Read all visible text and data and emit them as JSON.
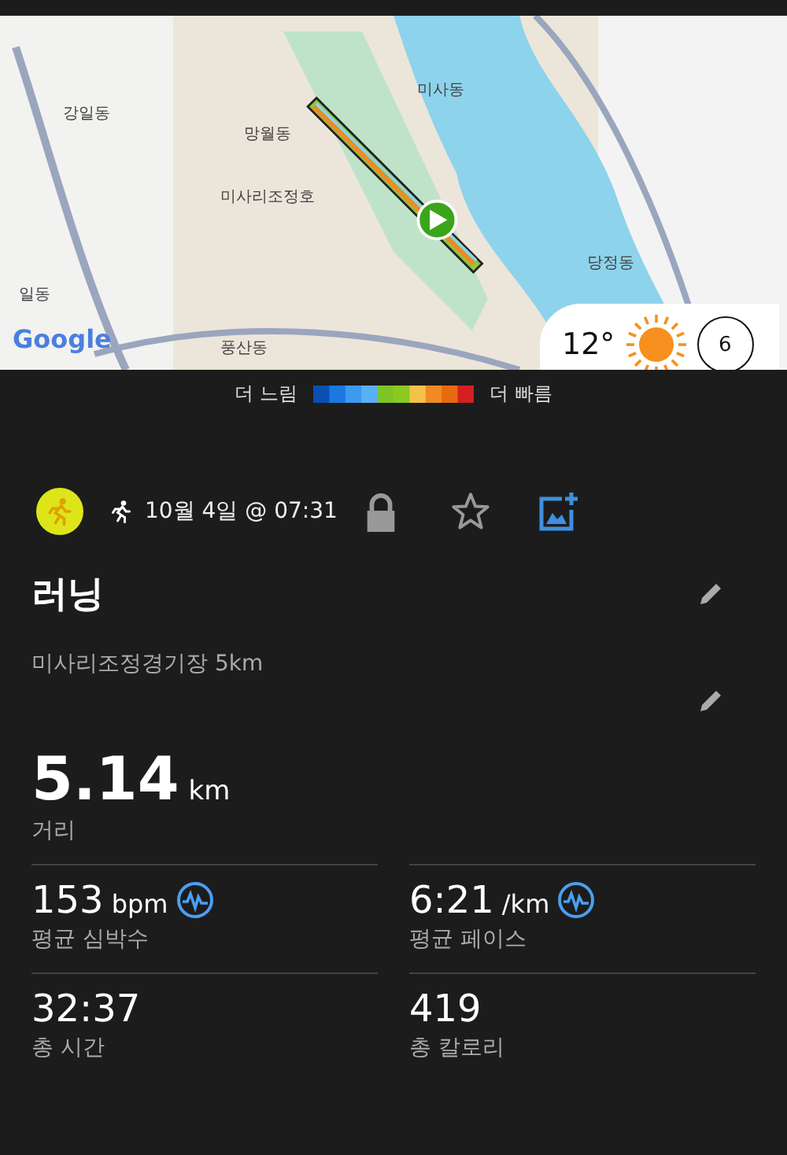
{
  "map": {
    "labels": [
      "강일동",
      "망월동",
      "미사동",
      "미사리조정호",
      "당정동",
      "일동",
      "풍산동"
    ],
    "attribution": "Google",
    "weather": {
      "temperature": "12°",
      "badge": "6"
    }
  },
  "legend": {
    "slow": "더 느림",
    "fast": "더 빠름"
  },
  "activity": {
    "date": "10월 4일 @ 07:31",
    "title": "러닝",
    "description": "미사리조정경기장 5km"
  },
  "distance": {
    "value": "5.14",
    "unit": "km",
    "label": "거리"
  },
  "stats": [
    {
      "value": "153",
      "unit": "bpm",
      "label": "평균 심박수",
      "chart_link": true
    },
    {
      "value": "6:21",
      "unit": "/km",
      "label": "평균 페이스",
      "chart_link": true
    },
    {
      "value": "32:37",
      "label": "총 시간",
      "chart_link": false
    },
    {
      "value": "419",
      "label": "총 칼로리",
      "chart_link": false
    }
  ]
}
